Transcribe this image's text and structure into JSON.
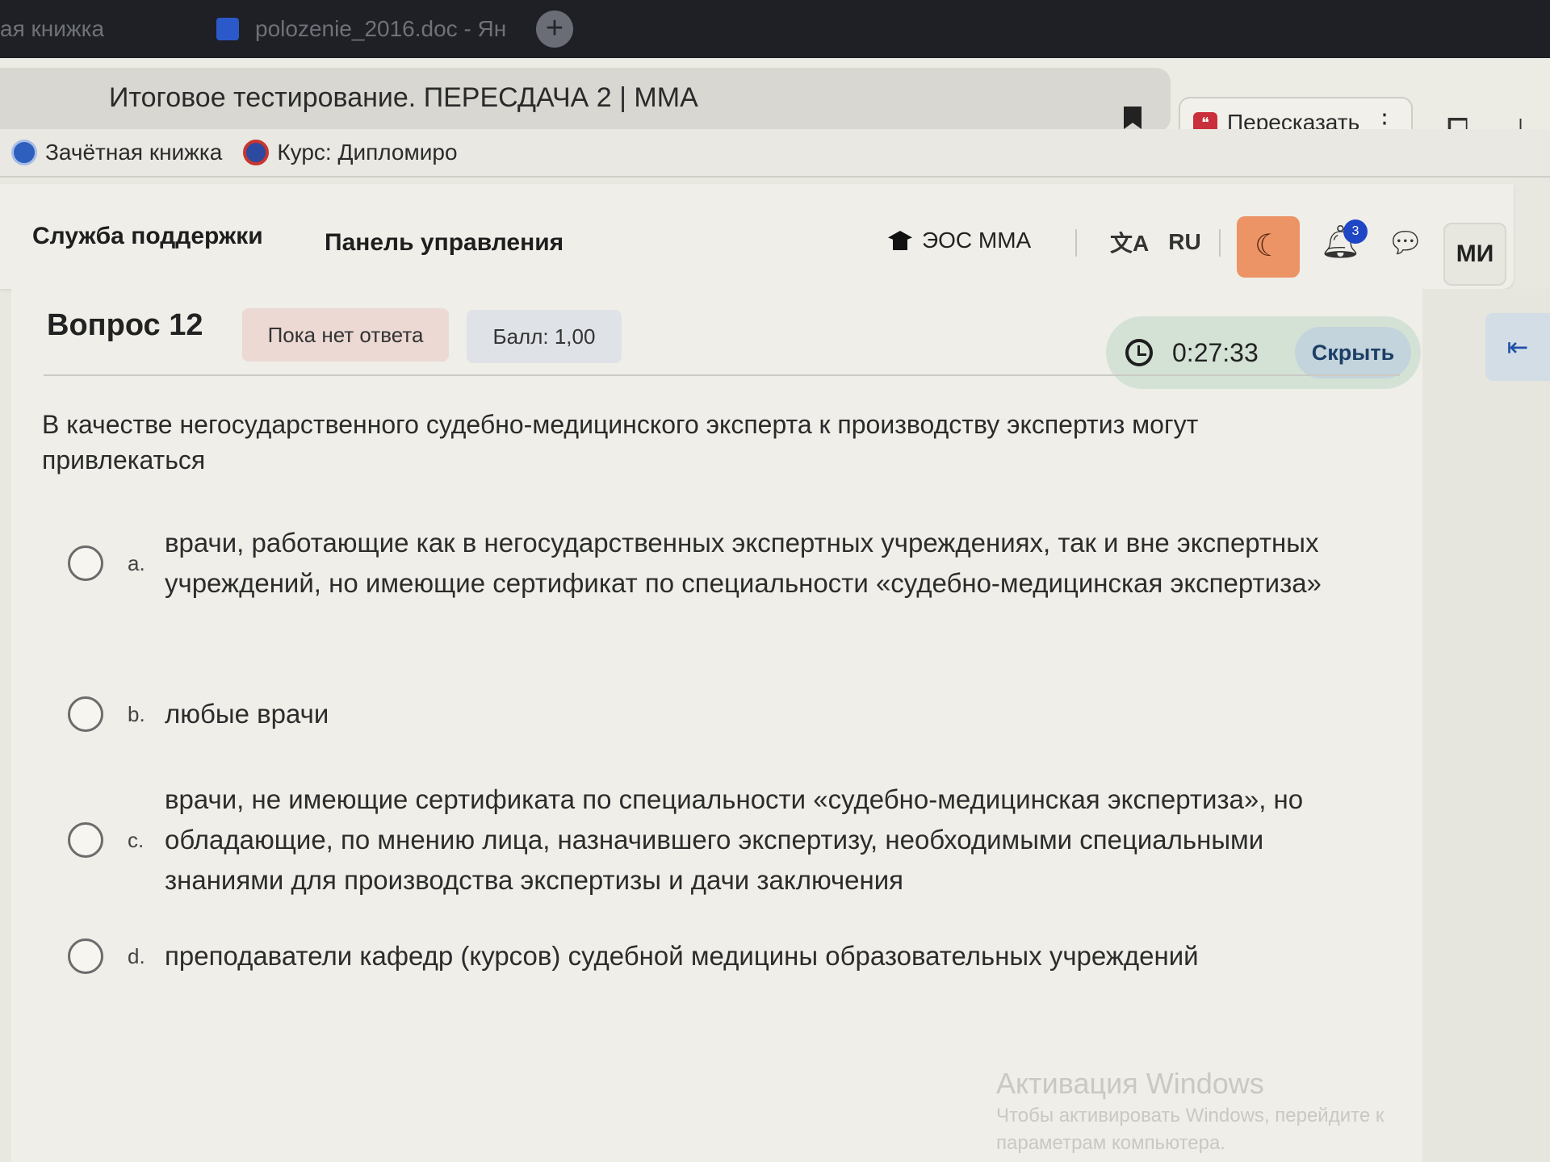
{
  "browser": {
    "tabs": [
      {
        "label": "ая книжка"
      },
      {
        "label": "polozenie_2016.doc - Ян"
      }
    ],
    "new_tab_symbol": "+",
    "page_title": "Итоговое тестирование. ПЕРЕСДАЧА 2 | ММА",
    "retell_label": "Пересказать",
    "bookmarks": [
      {
        "label": "Зачётная книжка"
      },
      {
        "label": "Курс: Дипломиро"
      }
    ]
  },
  "navbar": {
    "support_label": "Служба поддержки",
    "dashboard_label": "Панель управления",
    "site_label": "ЭОС ММА",
    "lang_label": "RU",
    "notification_count": "3",
    "avatar_initials": "МИ"
  },
  "question": {
    "title": "Вопрос 12",
    "status": "Пока нет ответа",
    "grade": "Балл: 1,00",
    "timer": "0:27:33",
    "hide_label": "Скрыть",
    "text": "В качестве негосударственного судебно-медицинского эксперта к производству экспертиз могут привлекаться",
    "answers": [
      {
        "letter": "a.",
        "text": "врачи, работающие как в негосударственных экспертных учреждениях, так и вне экспертных учреждений, но имеющие сертификат по специальности «судебно-медицинская экспертиза»"
      },
      {
        "letter": "b.",
        "text": "любые врачи"
      },
      {
        "letter": "c.",
        "text": "врачи, не имеющие сертификата по специальности «судебно-медицинская экспертиза», но обладающие, по мнению лица, назначившего экспертизу, необходимыми специальными знаниями для производства экспертизы и дачи заключения"
      },
      {
        "letter": "d.",
        "text": "преподаватели кафедр (курсов) судебной медицины образовательных учреждений"
      }
    ]
  },
  "watermark": {
    "title": "Активация Windows",
    "line1": "Чтобы активировать Windows, перейдите к",
    "line2": "параметрам компьютера."
  }
}
